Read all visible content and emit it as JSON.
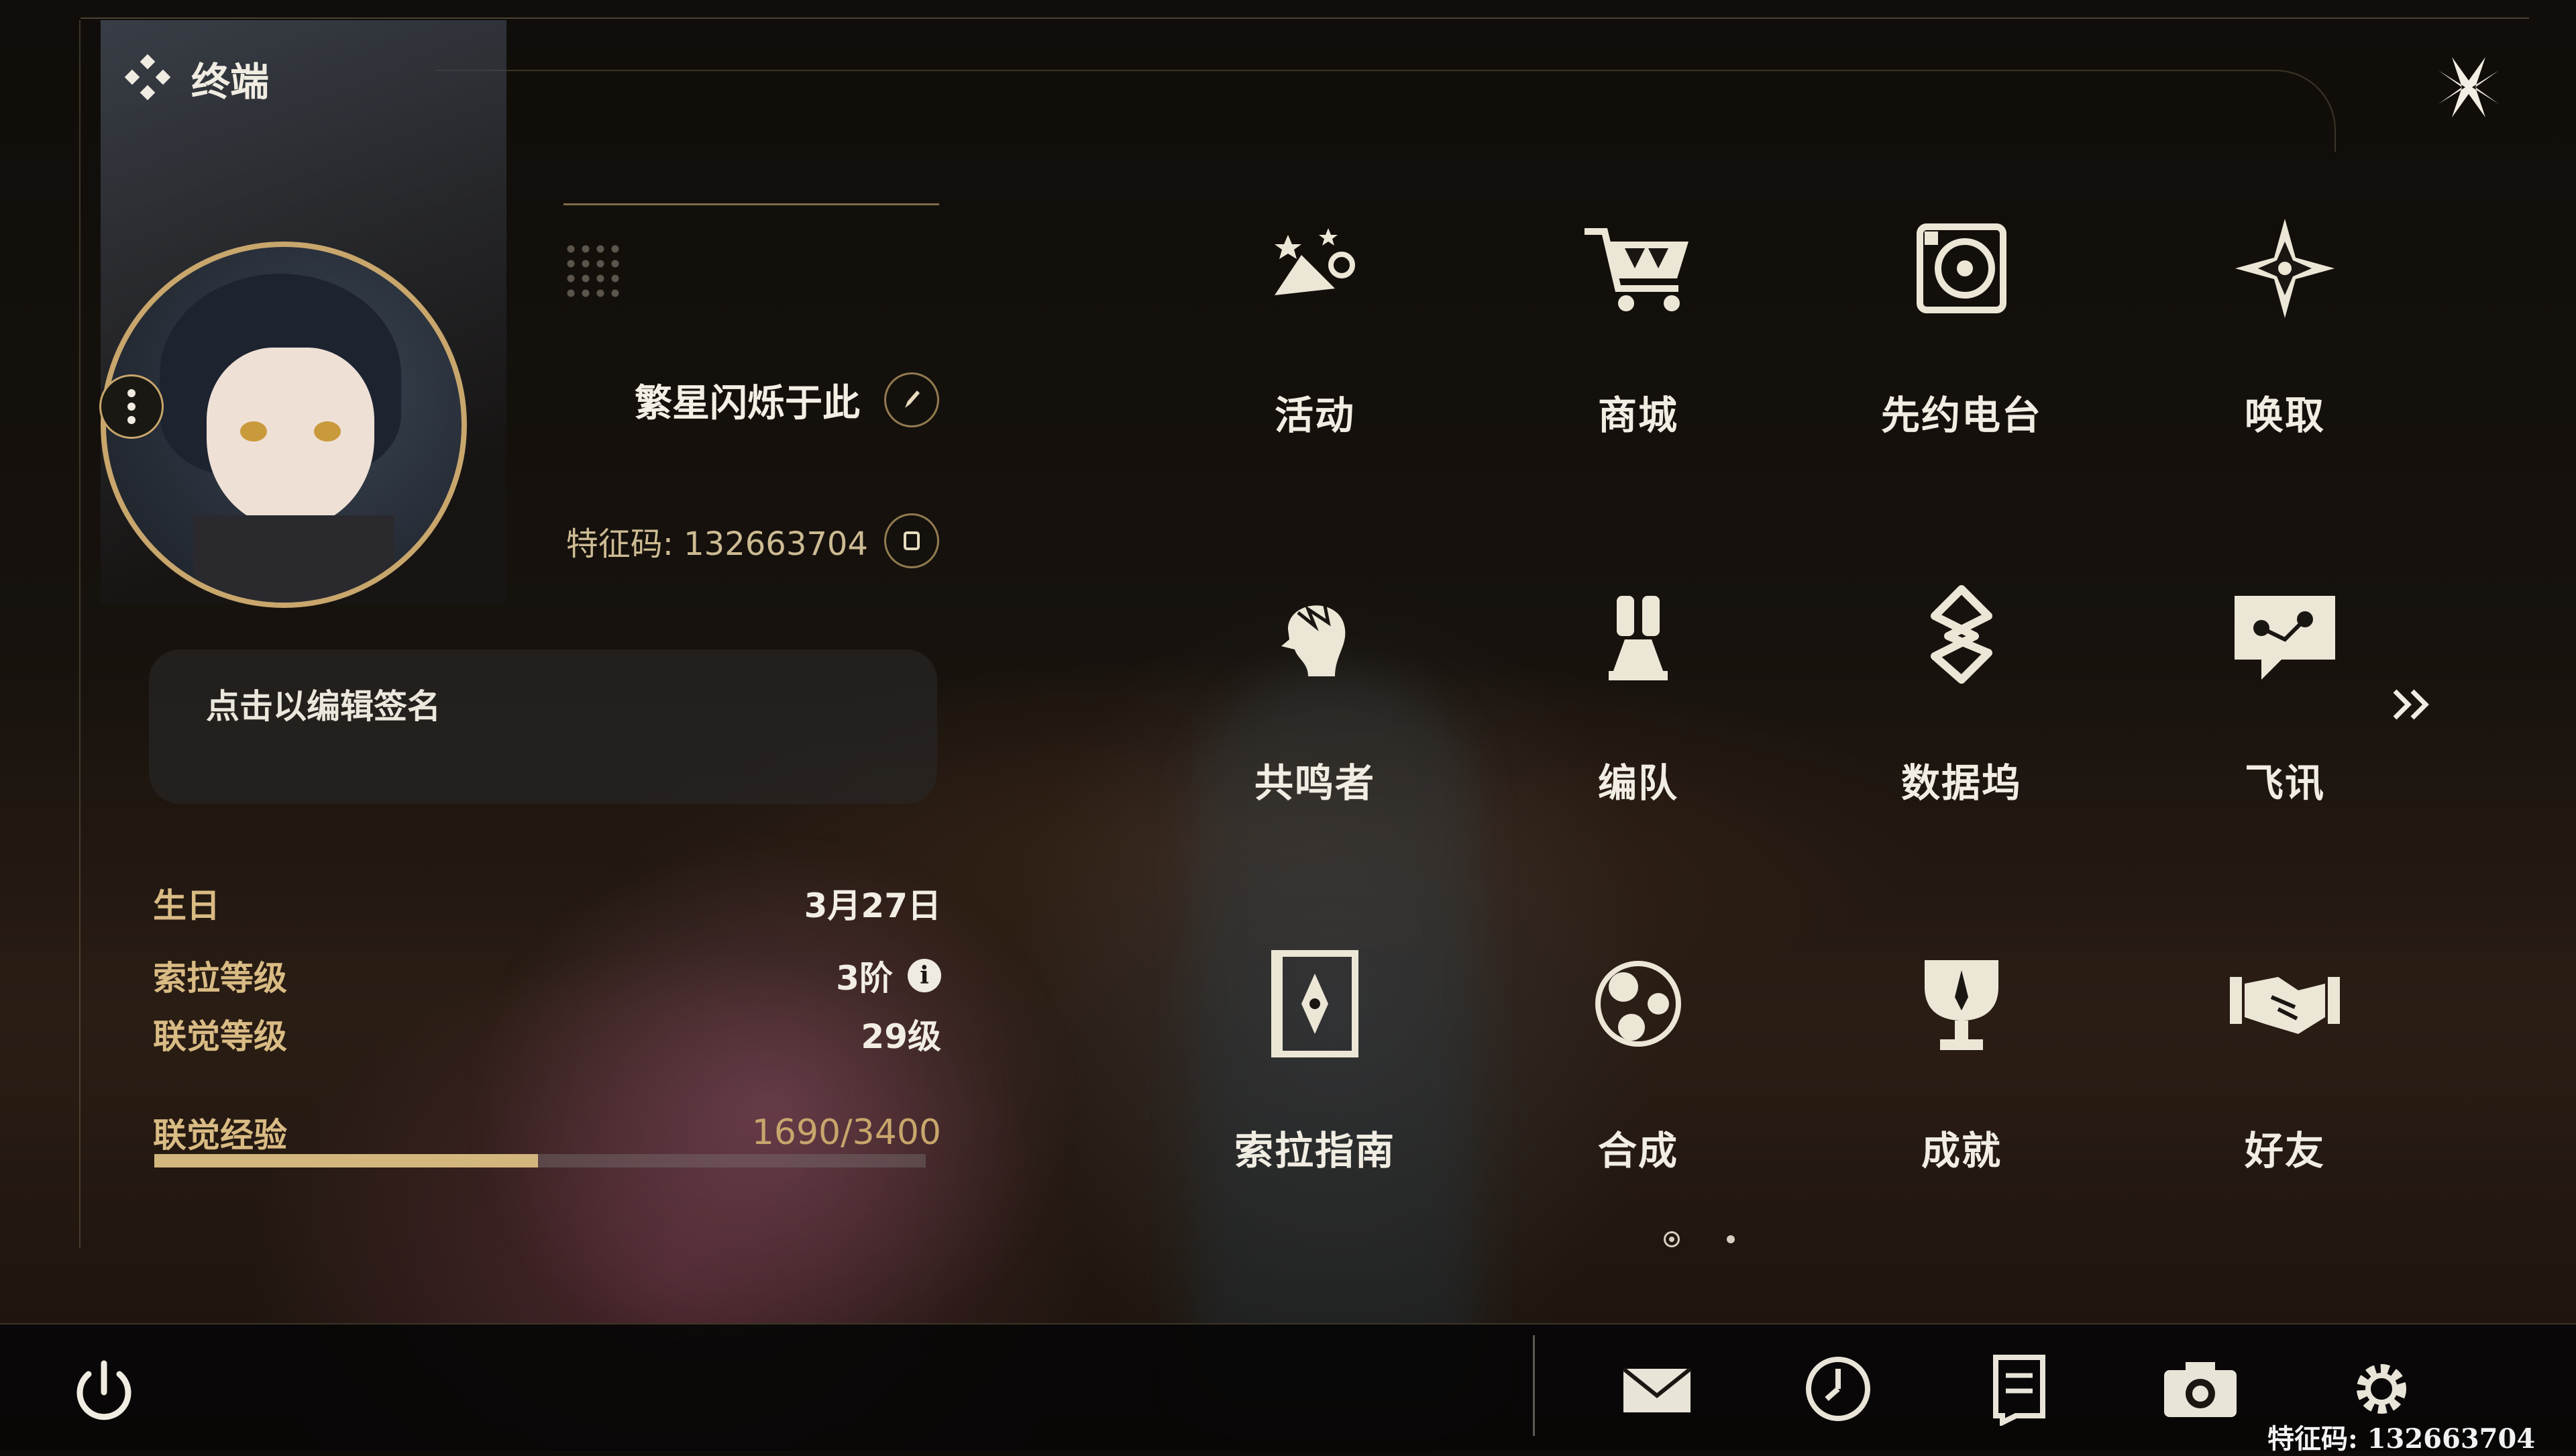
{
  "header": {
    "title": "终端"
  },
  "profile": {
    "name": "繁星闪烁于此",
    "id_label": "特征码: 132663704",
    "signature_placeholder": "点击以编辑签名"
  },
  "stats": {
    "birthday_label": "生日",
    "birthday_value": "3月27日",
    "sola_level_label": "索拉等级",
    "sola_level_value": "3阶",
    "union_level_label": "联觉等级",
    "union_level_value": "29级",
    "exp_label": "联觉经验",
    "exp_value": "1690/3400",
    "exp_current": 1690,
    "exp_max": 3400
  },
  "menu": [
    {
      "label": "活动",
      "icon": "activity-icon"
    },
    {
      "label": "商城",
      "icon": "shop-cart-icon"
    },
    {
      "label": "先约电台",
      "icon": "radio-icon"
    },
    {
      "label": "唤取",
      "icon": "convene-icon"
    },
    {
      "label": "共鸣者",
      "icon": "resonator-icon"
    },
    {
      "label": "编队",
      "icon": "team-icon"
    },
    {
      "label": "数据坞",
      "icon": "data-bank-icon"
    },
    {
      "label": "飞讯",
      "icon": "message-icon"
    },
    {
      "label": "索拉指南",
      "icon": "guidebook-icon"
    },
    {
      "label": "合成",
      "icon": "synthesis-icon"
    },
    {
      "label": "成就",
      "icon": "achievement-icon"
    },
    {
      "label": "好友",
      "icon": "friends-icon"
    }
  ],
  "pagination": {
    "current": 1,
    "total": 2
  },
  "bottom_bar": {
    "icons": [
      "power-icon",
      "mail-icon",
      "clock-icon",
      "notes-icon",
      "camera-icon",
      "settings-icon"
    ]
  },
  "watermark": "特征码: 132663704",
  "colors": {
    "accent": "#c8a66c",
    "text": "#ece6d6",
    "label": "#d9bb84"
  }
}
